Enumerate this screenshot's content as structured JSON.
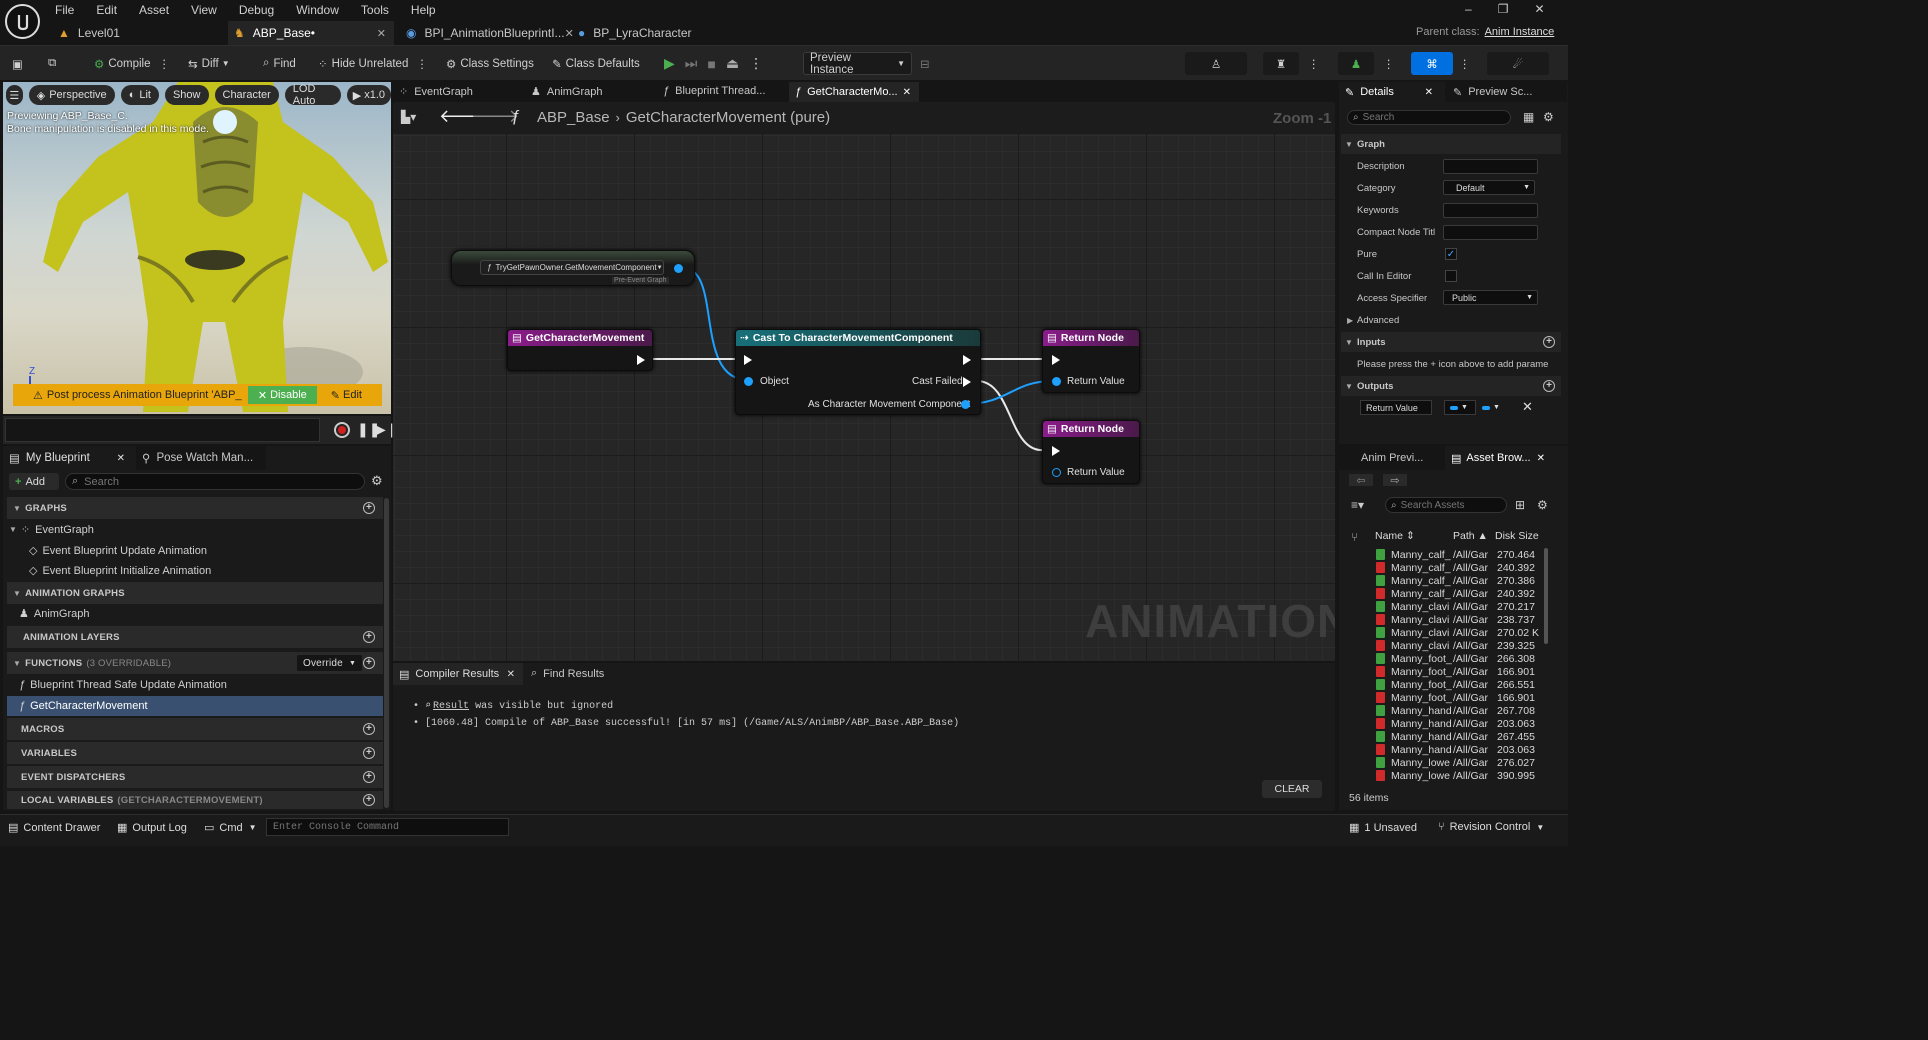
{
  "titlebar": {
    "menu": [
      "File",
      "Edit",
      "Asset",
      "View",
      "Debug",
      "Window",
      "Tools",
      "Help"
    ],
    "tabs": [
      {
        "label": "Level01"
      },
      {
        "label": "ABP_Base•"
      },
      {
        "label": "BPI_AnimationBlueprintI..."
      },
      {
        "label": "BP_LyraCharacter"
      }
    ],
    "parent_class_label": "Parent class:",
    "parent_class_value": "Anim Instance"
  },
  "toolbar": {
    "compile": "Compile",
    "diff": "Diff",
    "find": "Find",
    "hide_unrelated": "Hide Unrelated",
    "class_settings": "Class Settings",
    "class_defaults": "Class Defaults",
    "preview_instance": "Preview Instance"
  },
  "viewport": {
    "perspective": "Perspective",
    "lit": "Lit",
    "show": "Show",
    "character": "Character",
    "lod": "LOD Auto",
    "speed": "x1.0",
    "preview_line1": "Previewing ABP_Base_C.",
    "preview_line2": "Bone manipulation is disabled in this mode.",
    "warning": "Post process Animation Blueprint 'ABP_M",
    "disable": "Disable",
    "edit": "Edit",
    "axis": "Z"
  },
  "my_blueprint": {
    "tab1": "My Blueprint",
    "tab2": "Pose Watch Man...",
    "add": "Add",
    "search_placeholder": "Search",
    "graphs": "GRAPHS",
    "eventgraph": "EventGraph",
    "event_update": "Event Blueprint Update Animation",
    "event_init": "Event Blueprint Initialize Animation",
    "anim_graphs": "ANIMATION GRAPHS",
    "animgraph": "AnimGraph",
    "anim_layers": "ANIMATION LAYERS",
    "functions": "FUNCTIONS",
    "functions_count": "(3 OVERRIDABLE)",
    "override": "Override",
    "thread_safe": "Blueprint Thread Safe Update Animation",
    "get_char_move": "GetCharacterMovement",
    "macros": "MACROS",
    "variables": "VARIABLES",
    "dispatchers": "EVENT DISPATCHERS",
    "local_vars": "LOCAL VARIABLES",
    "local_vars_sub": "(GETCHARACTERMOVEMENT)"
  },
  "graph_tabs": [
    "EventGraph",
    "AnimGraph",
    "Blueprint Thread...",
    "GetCharacterMo..."
  ],
  "breadcrumb": {
    "root": "ABP_Base",
    "current": "GetCharacterMovement (pure)",
    "zoom": "Zoom -1"
  },
  "nodes": {
    "try_get": "TryGetPawnOwner.GetMovementComponent",
    "pre_event": "Pre-Event Graph",
    "entry": "GetCharacterMovement",
    "cast": "Cast To CharacterMovementComponent",
    "object": "Object",
    "cast_failed": "Cast Failed",
    "as_cmc": "As Character Movement Component",
    "return1": "Return Node",
    "return_value1": "Return Value",
    "return2": "Return Node",
    "return_value2": "Return Value"
  },
  "watermark": "ANIMATION",
  "compiler": {
    "tab1": "Compiler Results",
    "tab2": "Find Results",
    "line1_link": "Result",
    "line1_rest": " was visible but ignored",
    "line2": "[1060.48] Compile of ABP_Base successful! [in 57 ms] (/Game/ALS/AnimBP/ABP_Base.ABP_Base)",
    "clear": "CLEAR"
  },
  "details": {
    "tab1": "Details",
    "tab2": "Preview Sc...",
    "search_placeholder": "Search",
    "graph": "Graph",
    "description": "Description",
    "category": "Category",
    "category_value": "Default",
    "keywords": "Keywords",
    "compact": "Compact Node Titl",
    "pure": "Pure",
    "call_in_editor": "Call In Editor",
    "access": "Access Specifier",
    "access_value": "Public",
    "advanced": "Advanced",
    "inputs": "Inputs",
    "inputs_hint": "Please press the + icon above to add parame",
    "outputs": "Outputs",
    "return_value": "Return Value"
  },
  "asset_browser": {
    "tab1": "Anim Previ...",
    "tab2": "Asset Brow...",
    "search_placeholder": "Search Assets",
    "col_name": "Name",
    "col_path": "Path",
    "col_size": "Disk Size",
    "rows": [
      {
        "name": "Manny_calf_",
        "path": "/All/Gar",
        "size": "270.464",
        "color": "#3fa13f"
      },
      {
        "name": "Manny_calf_",
        "path": "/All/Gar",
        "size": "240.392",
        "color": "#d02a2a"
      },
      {
        "name": "Manny_calf_",
        "path": "/All/Gar",
        "size": "270.386",
        "color": "#3fa13f"
      },
      {
        "name": "Manny_calf_",
        "path": "/All/Gar",
        "size": "240.392",
        "color": "#d02a2a"
      },
      {
        "name": "Manny_clavi",
        "path": "/All/Gar",
        "size": "270.217",
        "color": "#3fa13f"
      },
      {
        "name": "Manny_clavi",
        "path": "/All/Gar",
        "size": "238.737",
        "color": "#d02a2a"
      },
      {
        "name": "Manny_clavi",
        "path": "/All/Gar",
        "size": "270.02 K",
        "color": "#3fa13f"
      },
      {
        "name": "Manny_clavi",
        "path": "/All/Gar",
        "size": "239.325",
        "color": "#d02a2a"
      },
      {
        "name": "Manny_foot_",
        "path": "/All/Gar",
        "size": "266.308",
        "color": "#3fa13f"
      },
      {
        "name": "Manny_foot_",
        "path": "/All/Gar",
        "size": "166.901",
        "color": "#d02a2a"
      },
      {
        "name": "Manny_foot_",
        "path": "/All/Gar",
        "size": "266.551",
        "color": "#3fa13f"
      },
      {
        "name": "Manny_foot_",
        "path": "/All/Gar",
        "size": "166.901",
        "color": "#d02a2a"
      },
      {
        "name": "Manny_hand",
        "path": "/All/Gar",
        "size": "267.708",
        "color": "#3fa13f"
      },
      {
        "name": "Manny_hand",
        "path": "/All/Gar",
        "size": "203.063",
        "color": "#d02a2a"
      },
      {
        "name": "Manny_hand",
        "path": "/All/Gar",
        "size": "267.455",
        "color": "#3fa13f"
      },
      {
        "name": "Manny_hand",
        "path": "/All/Gar",
        "size": "203.063",
        "color": "#d02a2a"
      },
      {
        "name": "Manny_lowe",
        "path": "/All/Gar",
        "size": "276.027",
        "color": "#3fa13f"
      },
      {
        "name": "Manny_lowe",
        "path": "/All/Gar",
        "size": "390.995",
        "color": "#d02a2a"
      }
    ],
    "count": "56 items"
  },
  "statusbar": {
    "content_drawer": "Content Drawer",
    "output_log": "Output Log",
    "cmd": "Cmd",
    "console_placeholder": "Enter Console Command",
    "unsaved": "1 Unsaved",
    "revision": "Revision Control"
  }
}
